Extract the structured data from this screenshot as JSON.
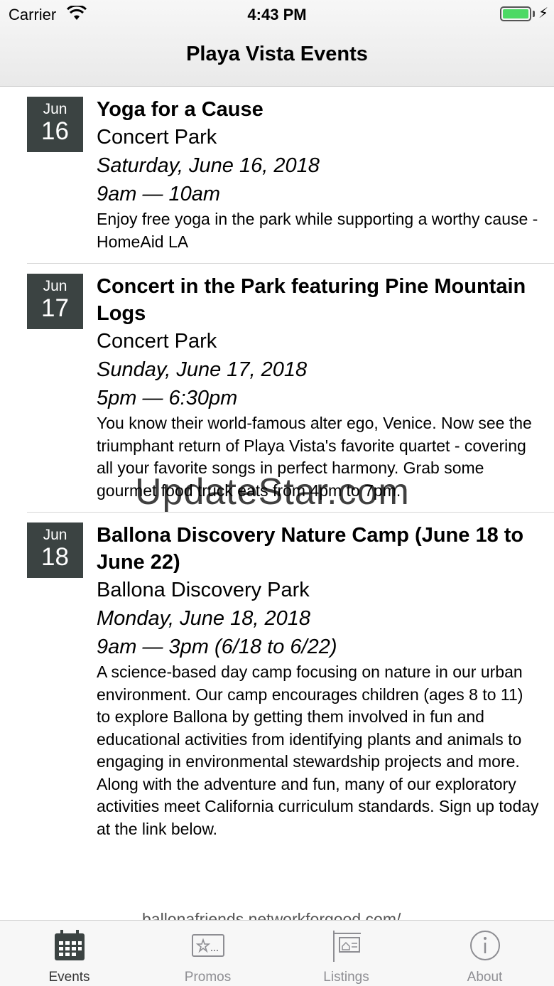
{
  "status_bar": {
    "carrier": "Carrier",
    "time": "4:43 PM",
    "battery_color": "#4cd964"
  },
  "nav": {
    "title": "Playa Vista Events"
  },
  "events": [
    {
      "month": "Jun",
      "day": "16",
      "title": "Yoga for a Cause",
      "location": "Concert Park",
      "date": "Saturday, June 16, 2018",
      "hours": "9am — 10am",
      "description": "Enjoy free yoga in the park while supporting a worthy cause - HomeAid LA"
    },
    {
      "month": "Jun",
      "day": "17",
      "title": "Concert in the Park featuring Pine Mountain Logs",
      "location": "Concert Park",
      "date": "Sunday, June 17, 2018",
      "hours": "5pm — 6:30pm",
      "description": "You know their world-famous alter ego, Venice. Now see the triumphant return of Playa Vista's favorite quartet - covering all your favorite songs in perfect harmony. Grab some gourmet food truck eats from 4pm to 7pm."
    },
    {
      "month": "Jun",
      "day": "18",
      "title": "Ballona Discovery Nature Camp (June 18 to June 22)",
      "location": "Ballona Discovery Park",
      "date": "Monday, June 18, 2018",
      "hours": "9am — 3pm (6/18 to 6/22)",
      "description": "A science-based day camp focusing on nature in our urban environment. Our camp encourages children (ages 8 to 11) to explore Ballona by getting them involved in fun and educational activities from identifying plants and animals to engaging in environmental stewardship projects and more. Along with the adventure and fun, many of our exploratory activities meet California curriculum standards.  Sign up today at the link below."
    }
  ],
  "partial_link": "ballonafriends.networkforgood.com/",
  "watermark": "UpdateStar.com",
  "tabs": [
    {
      "label": "Events",
      "icon": "calendar-icon",
      "active": true
    },
    {
      "label": "Promos",
      "icon": "promo-ticket-icon",
      "active": false
    },
    {
      "label": "Listings",
      "icon": "listing-sign-icon",
      "active": false
    },
    {
      "label": "About",
      "icon": "info-icon",
      "active": false
    }
  ]
}
